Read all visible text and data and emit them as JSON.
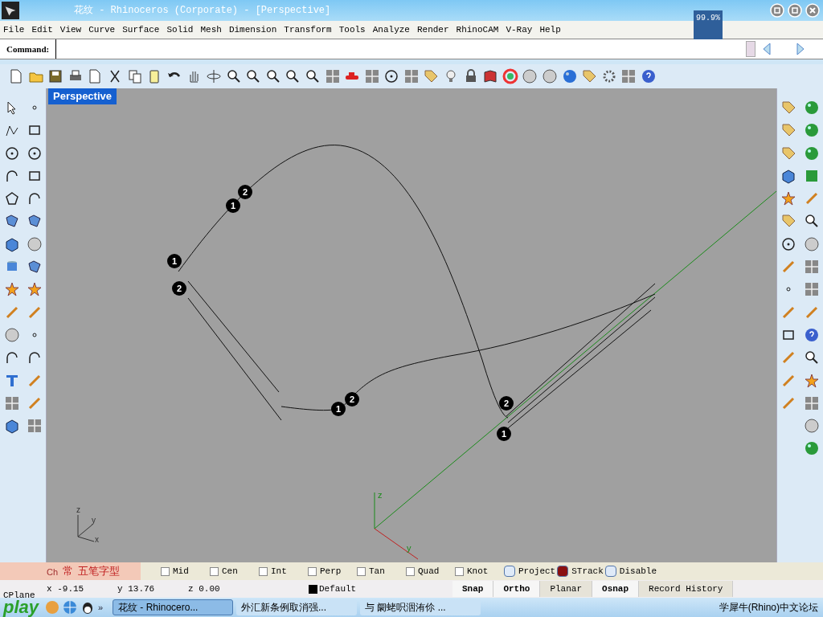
{
  "window": {
    "title": "花纹 - Rhinoceros (Corporate) - [Perspective]",
    "zoom_badge": "99.9%"
  },
  "menu": [
    "File",
    "Edit",
    "View",
    "Curve",
    "Surface",
    "Solid",
    "Mesh",
    "Dimension",
    "Transform",
    "Tools",
    "Analyze",
    "Render",
    "RhinoCAM",
    "V-Ray",
    "Help"
  ],
  "command": {
    "label": "Command:"
  },
  "viewport": {
    "title": "Perspective",
    "markers": [
      "1",
      "2",
      "1",
      "2",
      "1",
      "2",
      "2",
      "1"
    ],
    "world_axes": [
      "z",
      "y"
    ],
    "corner_axes": [
      "z",
      "y",
      "x"
    ]
  },
  "osnaps": [
    {
      "label": "Mid",
      "checked": false,
      "kind": "square"
    },
    {
      "label": "Cen",
      "checked": false,
      "kind": "square"
    },
    {
      "label": "Int",
      "checked": false,
      "kind": "square"
    },
    {
      "label": "Perp",
      "checked": false,
      "kind": "square"
    },
    {
      "label": "Tan",
      "checked": false,
      "kind": "square"
    },
    {
      "label": "Quad",
      "checked": false,
      "kind": "square"
    },
    {
      "label": "Knot",
      "checked": false,
      "kind": "square"
    },
    {
      "label": "Project",
      "checked": false,
      "kind": "round"
    },
    {
      "label": "STrack",
      "checked": true,
      "kind": "round"
    },
    {
      "label": "Disable",
      "checked": false,
      "kind": "round"
    }
  ],
  "status": {
    "cplane": "CPlane",
    "x": "x -9.15",
    "y": "y 13.76",
    "z": "z 0.00",
    "layer": "Default",
    "toggles": [
      {
        "label": "Snap",
        "on": true
      },
      {
        "label": "Ortho",
        "on": true
      },
      {
        "label": "Planar",
        "on": false
      },
      {
        "label": "Osnap",
        "on": true
      },
      {
        "label": "Record History",
        "on": false
      }
    ]
  },
  "ime": {
    "mode": "Ch",
    "punct": "常",
    "name": "五笔字型"
  },
  "taskbar": {
    "logo": "play",
    "chevron": "»",
    "tasks": [
      {
        "label": "花纹 - Rhinocero...",
        "selected": true
      },
      {
        "label": "外汇新条例取消强...",
        "selected": false
      },
      {
        "label": "与 阛蛯呮洇洧伱 ...",
        "selected": false
      }
    ],
    "tray": "学犀牛(Rhino)中文论坛"
  }
}
